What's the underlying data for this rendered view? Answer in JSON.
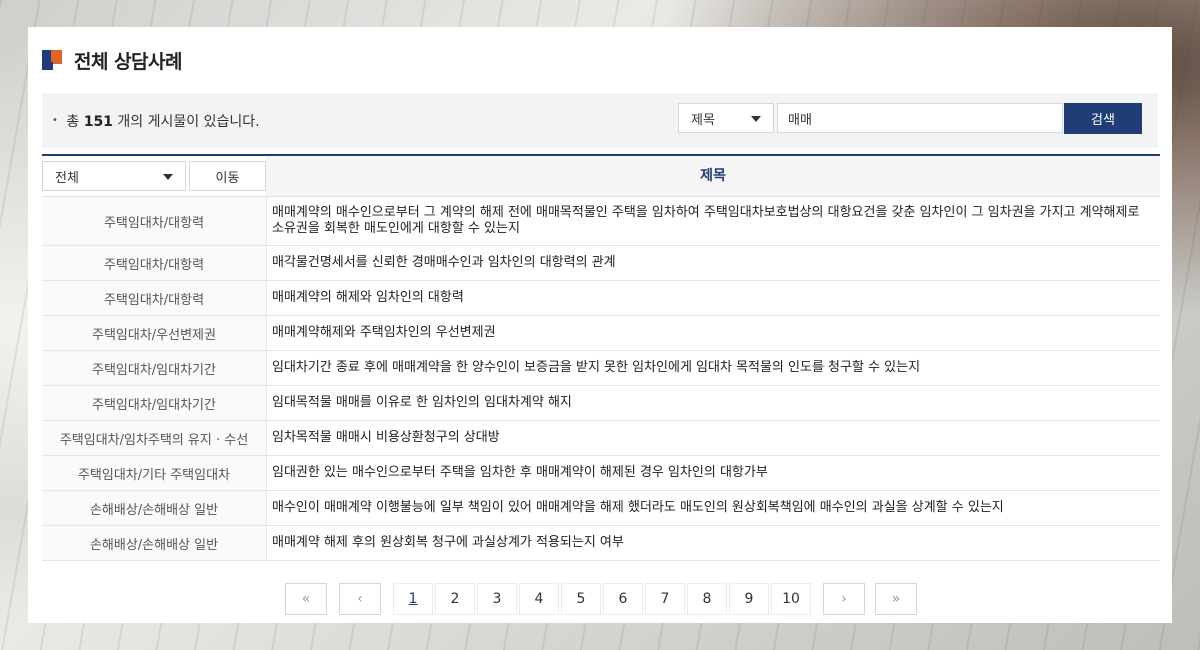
{
  "header": {
    "title": "전체 상담사례"
  },
  "search": {
    "count_prefix": "총",
    "count": "151",
    "count_suffix": "개의 게시물이 있습니다.",
    "field_option": "제목",
    "query": "매매",
    "button_label": "검색"
  },
  "table": {
    "category_filter": "전체",
    "move_label": "이동",
    "column_title": "제목",
    "rows": [
      {
        "category": "주택임대차/대항력",
        "subject": "매매계약의 매수인으로부터 그 계약의 해제 전에 매매목적물인 주택을 임차하여 주택임대차보호법상의 대항요건을 갖춘 임차인이 그 임차권을 가지고 계약해제로 소유권을 회복한 매도인에게 대항할 수 있는지"
      },
      {
        "category": "주택임대차/대항력",
        "subject": "매각물건명세서를 신뢰한 경매매수인과 임차인의 대항력의 관계"
      },
      {
        "category": "주택임대차/대항력",
        "subject": "매매계약의 해제와 임차인의 대항력"
      },
      {
        "category": "주택임대차/우선변제권",
        "subject": "매매계약해제와 주택임차인의 우선변제권"
      },
      {
        "category": "주택임대차/임대차기간",
        "subject": "임대차기간 종료 후에 매매계약을 한 양수인이 보증금을 받지 못한 임차인에게 임대차 목적물의 인도를 청구할 수 있는지"
      },
      {
        "category": "주택임대차/임대차기간",
        "subject": "임대목적물 매매를 이유로 한 임차인의 임대차계약 해지"
      },
      {
        "category": "주택임대차/임차주택의 유지 · 수선",
        "subject": "임차목적물 매매시 비용상환청구의 상대방"
      },
      {
        "category": "주택임대차/기타 주택임대차",
        "subject": "임대권한 있는 매수인으로부터 주택을 임차한 후 매매계약이 해제된 경우 임차인의 대항가부"
      },
      {
        "category": "손해배상/손해배상 일반",
        "subject": "매수인이 매매계약 이행불능에 일부 책임이 있어 매매계약을 해제 했더라도 매도인의 원상회복책임에 매수인의 과실을 상계할 수 있는지"
      },
      {
        "category": "손해배상/손해배상 일반",
        "subject": "매매계약 해제 후의 원상회복 청구에 과실상계가 적용되는지 여부"
      }
    ]
  },
  "pagination": {
    "first": "«",
    "prev": "‹",
    "next": "›",
    "last": "»",
    "pages": [
      "1",
      "2",
      "3",
      "4",
      "5",
      "6",
      "7",
      "8",
      "9",
      "10"
    ],
    "current": "1"
  },
  "icons": {
    "caret": "caret-down-icon",
    "title_mark": "title-mark-icon"
  },
  "colors": {
    "accent": "#213d76",
    "orange": "#e0632a"
  }
}
